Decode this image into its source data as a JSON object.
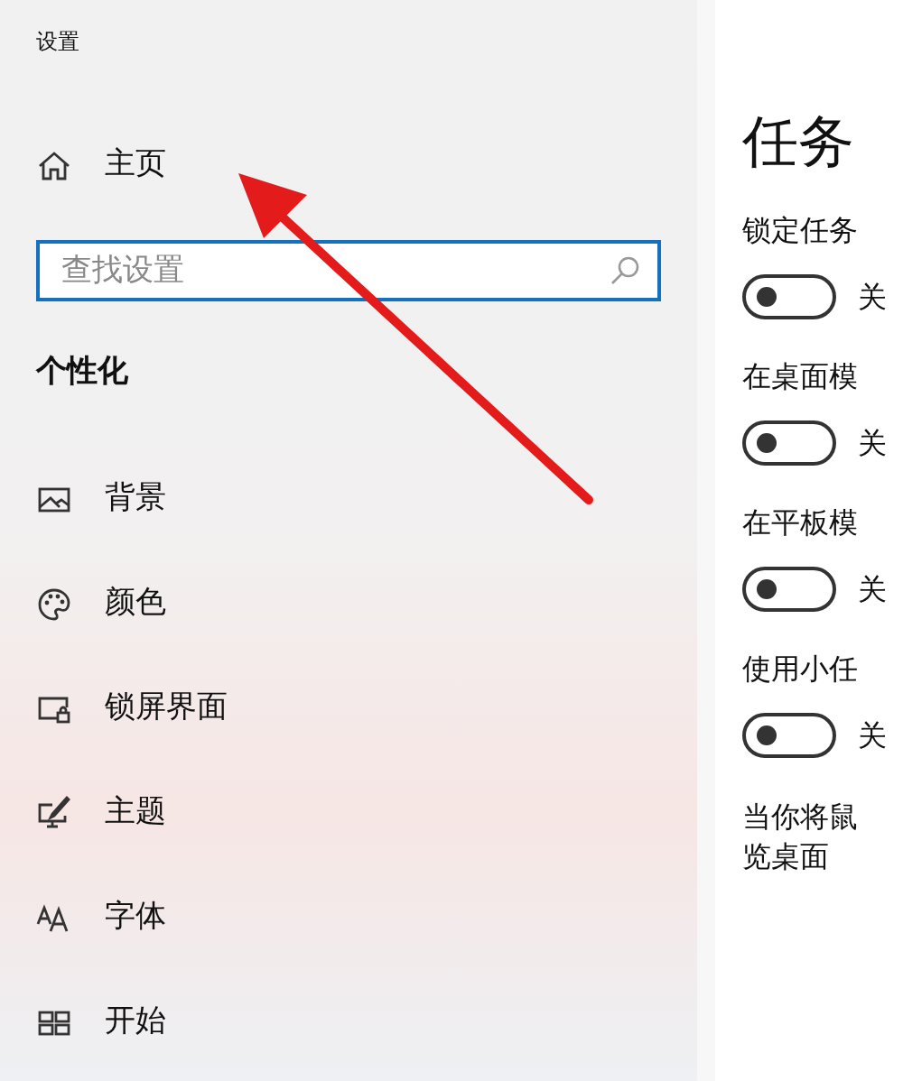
{
  "window": {
    "title": "设置"
  },
  "sidebar": {
    "home": "主页",
    "search": {
      "placeholder": "查找设置"
    },
    "section": "个性化",
    "items": [
      {
        "label": "背景"
      },
      {
        "label": "颜色"
      },
      {
        "label": "锁屏界面"
      },
      {
        "label": "主题"
      },
      {
        "label": "字体"
      },
      {
        "label": "开始"
      }
    ]
  },
  "content": {
    "title": "任务",
    "settings": [
      {
        "label": "锁定任务",
        "on": false,
        "state": "关"
      },
      {
        "label": "在桌面模",
        "on": false,
        "state": "关"
      },
      {
        "label": "在平板模",
        "on": false,
        "state": "关"
      },
      {
        "label": "使用小任",
        "on": false,
        "state": "关"
      }
    ],
    "note": [
      "当你将鼠",
      "览桌面"
    ]
  },
  "annotation": {
    "kind": "arrow"
  }
}
